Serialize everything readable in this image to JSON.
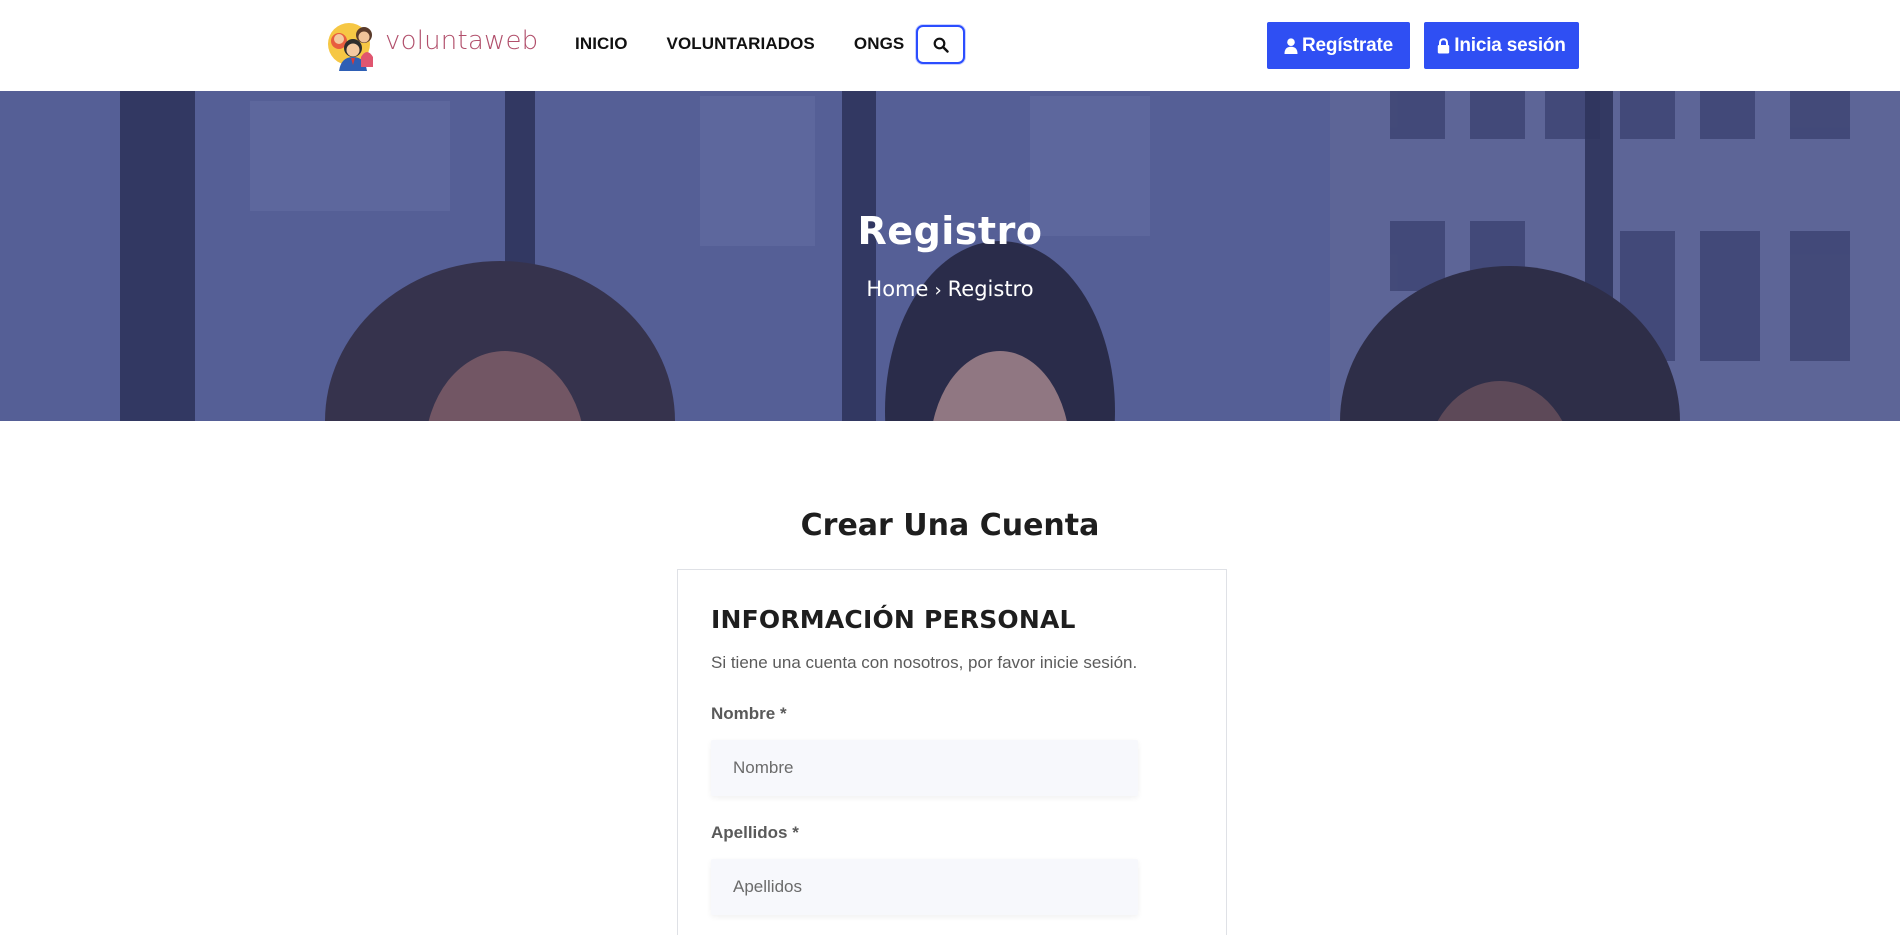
{
  "brand": {
    "name": "voluntaweb",
    "color": "#b14f6b"
  },
  "nav": {
    "items": [
      "INICIO",
      "VOLUNTARIADOS",
      "ONGS"
    ],
    "search_icon": "search-icon"
  },
  "auth": {
    "register_label": "Regístrate",
    "login_label": "Inicia sesión",
    "register_icon": "user-icon",
    "login_icon": "lock-icon",
    "accent": "#2f4ff3"
  },
  "hero": {
    "title": "Registro",
    "breadcrumb": {
      "home": "Home",
      "separator": "›",
      "current": "Registro"
    }
  },
  "main": {
    "title": "Crear Una Cuenta",
    "card": {
      "title": "INFORMACIÓN PERSONAL",
      "subtitle": "Si tiene una cuenta con nosotros, por favor inicie sesión.",
      "fields": [
        {
          "label": "Nombre *",
          "placeholder": "Nombre",
          "value": ""
        },
        {
          "label": "Apellidos *",
          "placeholder": "Apellidos",
          "value": ""
        }
      ]
    }
  }
}
